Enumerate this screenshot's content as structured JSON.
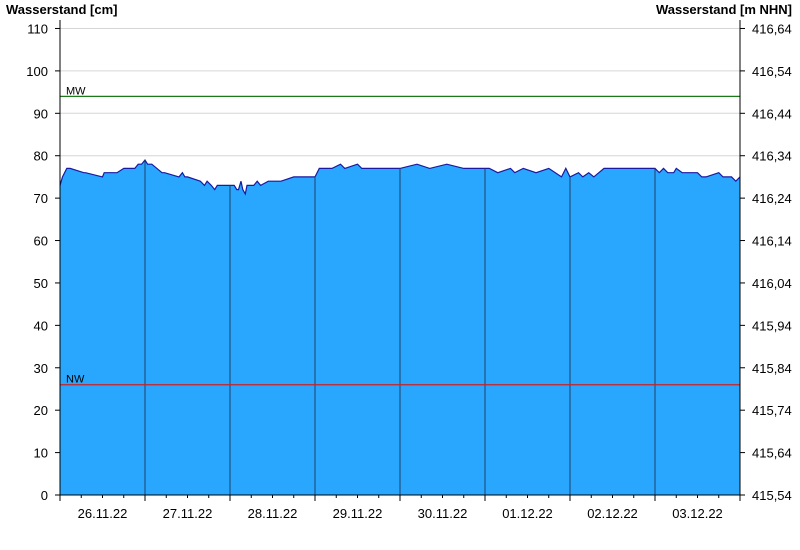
{
  "chart_data": {
    "type": "area",
    "ylabel_left": "Wasserstand [cm]",
    "ylabel_right": "Wasserstand [m NHN]",
    "ylim": [
      0,
      112
    ],
    "y_ticks": [
      0,
      10,
      20,
      30,
      40,
      50,
      60,
      70,
      80,
      90,
      100,
      110
    ],
    "y_right_ticks": [
      "415,54",
      "415,64",
      "415,74",
      "415,84",
      "415,94",
      "416,04",
      "416,14",
      "416,24",
      "416,34",
      "416,44",
      "416,54",
      "416,64"
    ],
    "x_range_days": [
      0,
      8
    ],
    "x_tick_labels": [
      "26.11.22",
      "27.11.22",
      "28.11.22",
      "29.11.22",
      "30.11.22",
      "01.12.22",
      "02.12.22",
      "03.12.22"
    ],
    "series": [
      {
        "x": [
          0,
          0.03,
          0.08,
          0.12,
          0.28,
          0.3,
          0.5,
          0.52,
          0.65,
          0.67,
          0.75,
          0.77,
          0.88,
          0.92,
          0.96,
          1.0,
          1.03,
          1.08,
          1.2,
          1.23,
          1.4,
          1.44,
          1.47,
          1.5,
          1.65,
          1.7,
          1.73,
          1.78,
          1.82,
          1.85,
          1.88,
          1.9,
          1.92,
          2.05,
          2.08,
          2.1,
          2.13,
          2.15,
          2.18,
          2.2,
          2.28,
          2.32,
          2.36,
          2.45,
          2.6,
          2.75,
          2.85,
          2.95,
          3.0,
          3.05,
          3.08,
          3.12,
          3.2,
          3.3,
          3.35,
          3.5,
          3.55,
          3.6,
          3.72,
          4.0,
          4.2,
          4.35,
          4.55,
          4.75,
          4.8,
          4.95,
          5.0,
          5.05,
          5.15,
          5.3,
          5.35,
          5.45,
          5.6,
          5.75,
          5.9,
          5.95,
          6.0,
          6.1,
          6.15,
          6.22,
          6.28,
          6.4,
          6.6,
          6.8,
          7.0,
          7.05,
          7.1,
          7.15,
          7.22,
          7.25,
          7.32,
          7.4,
          7.5,
          7.55,
          7.6,
          7.75,
          7.8,
          7.9,
          7.95,
          8.0
        ],
        "values": [
          73,
          75,
          77,
          77,
          76,
          76,
          75,
          76,
          76,
          76,
          77,
          77,
          77,
          78,
          78,
          79,
          78,
          78,
          76,
          76,
          75,
          76,
          75,
          75,
          74,
          73,
          74,
          73,
          72,
          73,
          73,
          73,
          73,
          73,
          72,
          72,
          74,
          72,
          71,
          73,
          73,
          74,
          73,
          74,
          74,
          75,
          75,
          75,
          75,
          77,
          77,
          77,
          77,
          78,
          77,
          78,
          77,
          77,
          77,
          77,
          78,
          77,
          78,
          77,
          77,
          77,
          77,
          77,
          76,
          77,
          76,
          77,
          76,
          77,
          75,
          77,
          75,
          76,
          75,
          76,
          75,
          77,
          77,
          77,
          77,
          76,
          77,
          76,
          76,
          77,
          76,
          76,
          76,
          75,
          75,
          76,
          75,
          75,
          74,
          75
        ]
      }
    ],
    "reference_lines": [
      {
        "label": "MW",
        "value": 94,
        "color": "#1a7a1a"
      },
      {
        "label": "NW",
        "value": 26,
        "color": "#cc2020"
      }
    ],
    "grid": true,
    "colors": {
      "fill": "#29a7ff",
      "line": "#1a1aa0",
      "gridline": "#d6d6d6",
      "day_separator": "#1f3f66"
    }
  }
}
